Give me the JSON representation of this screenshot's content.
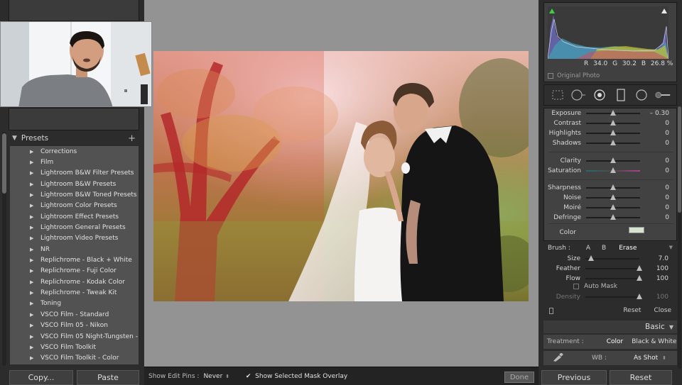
{
  "presets": {
    "header": "Presets",
    "add_icon": "+",
    "items": [
      "Corrections",
      "Film",
      "Lightroom B&W Filter Presets",
      "Lightroom B&W Presets",
      "Lightroom B&W Toned Presets",
      "Lightroom Color Presets",
      "Lightroom Effect Presets",
      "Lightroom General Presets",
      "Lightroom Video Presets",
      "NR",
      "Replichrome - Black + White",
      "Replichrome - Fuji Color",
      "Replichrome - Kodak Color",
      "Replichrome - Tweak Kit",
      "Toning",
      "VSCO Film - Standard",
      "VSCO Film 05 - Nikon",
      "VSCO Film 05 Night-Tungsten -...",
      "VSCO Film Toolkit",
      "VSCO Film Toolkit - Color"
    ]
  },
  "left_buttons": {
    "copy": "Copy...",
    "paste": "Paste"
  },
  "toolbar": {
    "edit_pins_label": "Show Edit Pins :",
    "edit_pins_value": "Never",
    "mask_overlay_checked": "✔",
    "mask_overlay_label": "Show Selected Mask Overlay",
    "done": "Done"
  },
  "histogram": {
    "r_label": "R",
    "r_value": "34.0",
    "g_label": "G",
    "g_value": "30.2",
    "b_label": "B",
    "b_value": "26.8 %",
    "original_photo": "Original Photo"
  },
  "adjustments": [
    {
      "name": "Exposure",
      "value": "– 0.30",
      "pos": 0.5
    },
    {
      "name": "Contrast",
      "value": "0",
      "pos": 0.5
    },
    {
      "name": "Highlights",
      "value": "0",
      "pos": 0.5
    },
    {
      "name": "Shadows",
      "value": "0",
      "pos": 0.5
    },
    {
      "name": "Clarity",
      "value": "0",
      "pos": 0.5
    },
    {
      "name": "Saturation",
      "value": "0",
      "pos": 0.5
    },
    {
      "name": "Sharpness",
      "value": "0",
      "pos": 0.5
    },
    {
      "name": "Noise",
      "value": "0",
      "pos": 0.5
    },
    {
      "name": "Moiré",
      "value": "0",
      "pos": 0.5
    },
    {
      "name": "Defringe",
      "value": "0",
      "pos": 0.5
    }
  ],
  "color_label": "Color",
  "mask_color": "#d5e3d0",
  "brush": {
    "label": "Brush :",
    "a": "A",
    "b": "B",
    "erase": "Erase",
    "size": {
      "name": "Size",
      "value": "7.0",
      "pos": 0.1
    },
    "feather": {
      "name": "Feather",
      "value": "100",
      "pos": 1.0
    },
    "flow": {
      "name": "Flow",
      "value": "100",
      "pos": 1.0
    },
    "auto_mask": "Auto Mask",
    "density": {
      "name": "Density",
      "value": "100",
      "pos": 1.0
    },
    "reset": "Reset",
    "close": "Close"
  },
  "basic": {
    "header": "Basic",
    "treatment_label": "Treatment :",
    "color": "Color",
    "bw": "Black & White",
    "wb_label": "WB :",
    "wb_value": "As Shot"
  },
  "right_buttons": {
    "previous": "Previous",
    "reset": "Reset"
  }
}
